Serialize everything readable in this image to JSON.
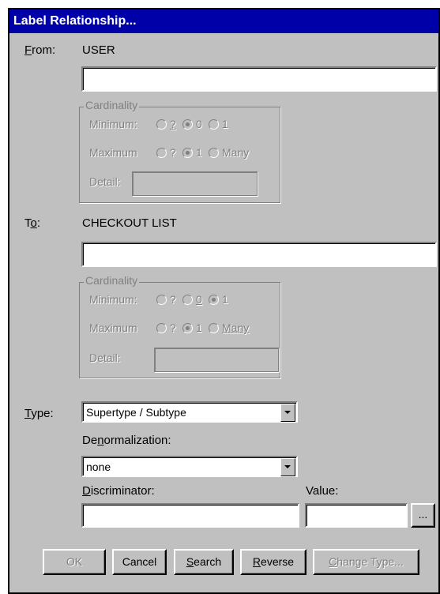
{
  "dialog": {
    "title": "Label Relationship..."
  },
  "from": {
    "label": "From:",
    "label_key": "F",
    "label_rest": "rom:",
    "entity": "USER",
    "text_value": "",
    "cardinality": {
      "title": "Cardinality",
      "minimum_label": "Minimum:",
      "maximum_label": "Maximum",
      "detail_label": "Detail:",
      "min_options": [
        "?",
        "0",
        "1"
      ],
      "min_selected": "0",
      "max_options": [
        "?",
        "1",
        "Many"
      ],
      "max_selected": "1",
      "detail_value": ""
    }
  },
  "to": {
    "label": "To:",
    "label_pre": "T",
    "label_key": "o",
    "label_post": ":",
    "entity": "CHECKOUT LIST",
    "text_value": "",
    "cardinality": {
      "title": "Cardinality",
      "minimum_label": "Minimum:",
      "maximum_label": "Maximum",
      "detail_label": "Detail:",
      "min_options": [
        "?",
        "0",
        "1"
      ],
      "min_selected": "1",
      "max_options": [
        "?",
        "1",
        "Many"
      ],
      "max_selected": "1",
      "detail_value": ""
    }
  },
  "type": {
    "label_key": "T",
    "label_rest": "ype:",
    "selected": "Supertype / Subtype"
  },
  "denormalization": {
    "label_pre": "De",
    "label_key": "n",
    "label_post": "ormalization:",
    "selected": "none"
  },
  "discriminator": {
    "label_key": "D",
    "label_rest": "iscriminator:",
    "value": ""
  },
  "value_field": {
    "label": "Value:",
    "value": "",
    "browse_label": "..."
  },
  "buttons": {
    "ok": "OK",
    "cancel": "Cancel",
    "search_key": "S",
    "search_rest": "earch",
    "reverse_key": "R",
    "reverse_rest": "everse",
    "change_type_key": "C",
    "change_type_rest": "hange Type..."
  }
}
